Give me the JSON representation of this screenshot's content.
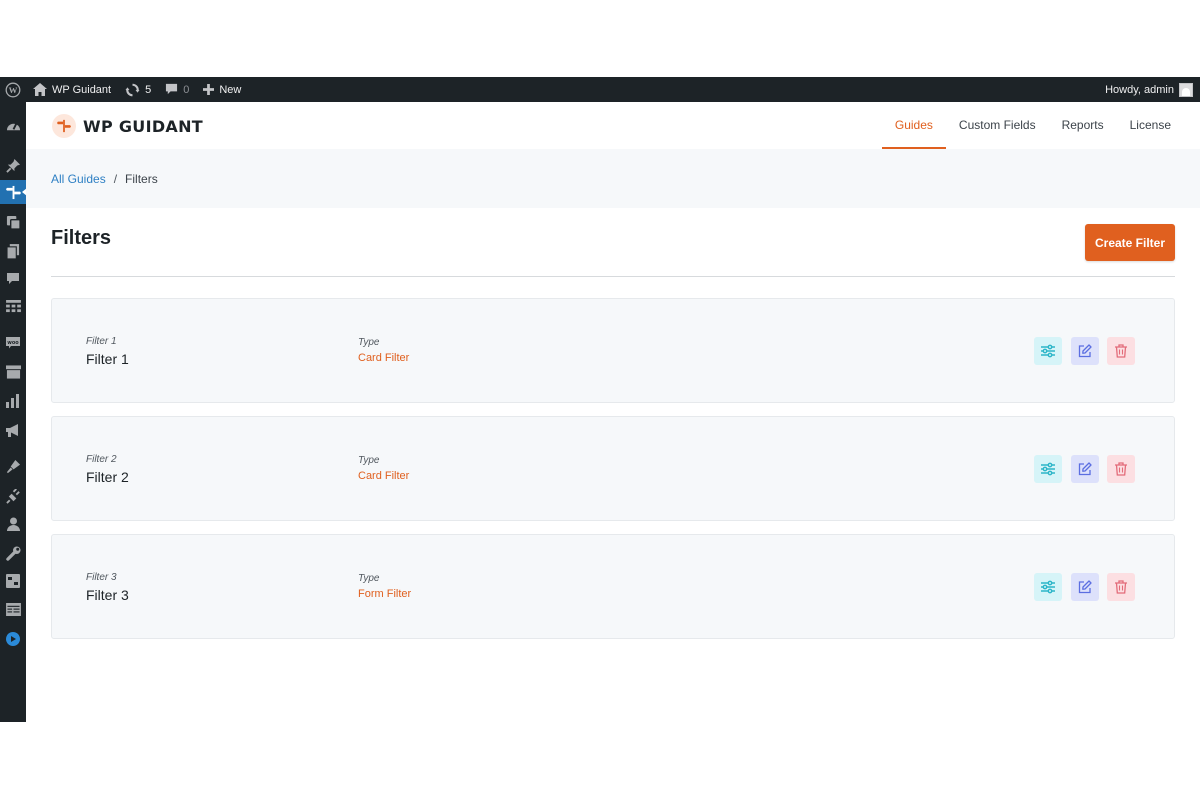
{
  "adminbar": {
    "site_name": "WP Guidant",
    "updates_count": "5",
    "comments_count": "0",
    "new_label": "New",
    "greeting": "Howdy, admin"
  },
  "sidebar": {
    "icons": [
      "dashboard-icon",
      "pin-icon",
      "guidant-icon",
      "media-icon",
      "pages-icon",
      "comments-icon",
      "table-icon",
      "woo-icon",
      "archive-icon",
      "analytics-icon",
      "megaphone-icon",
      "appearance-icon",
      "plugins-icon",
      "users-icon",
      "tools-icon",
      "settings-icon",
      "layout-icon",
      "play-icon"
    ],
    "active": "guidant-icon"
  },
  "brand": {
    "name": "WP GUIDANT"
  },
  "top_nav": {
    "tabs": [
      {
        "label": "Guides",
        "active": true
      },
      {
        "label": "Custom Fields",
        "active": false
      },
      {
        "label": "Reports",
        "active": false
      },
      {
        "label": "License",
        "active": false
      }
    ]
  },
  "breadcrumb": {
    "parent": "All Guides",
    "separator": "/",
    "current": "Filters"
  },
  "page": {
    "title": "Filters",
    "create_label": "Create Filter"
  },
  "filters": [
    {
      "name_label": "Filter 1",
      "name": "Filter 1",
      "type_label": "Type",
      "type": "Card Filter"
    },
    {
      "name_label": "Filter 2",
      "name": "Filter 2",
      "type_label": "Type",
      "type": "Card Filter"
    },
    {
      "name_label": "Filter 3",
      "name": "Filter 3",
      "type_label": "Type",
      "type": "Form Filter"
    }
  ],
  "colors": {
    "accent": "#e0601f",
    "admin_bar": "#1d2327",
    "link": "#2f80c4",
    "settings_icon": "#2bb5c8",
    "edit_icon": "#5b6ee1",
    "delete_icon": "#e36b79"
  }
}
